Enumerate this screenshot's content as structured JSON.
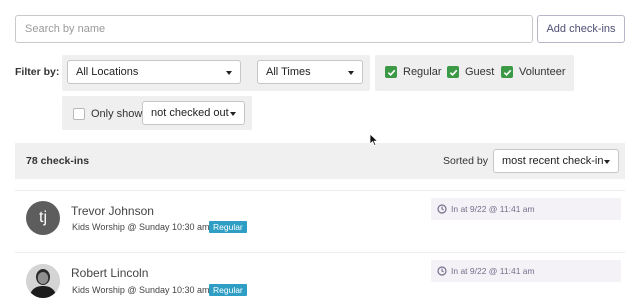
{
  "search": {
    "placeholder": "Search by name",
    "value": ""
  },
  "add_button": "Add check-ins",
  "filters": {
    "label": "Filter by:",
    "location": "All Locations",
    "time": "All Times",
    "kinds": [
      {
        "label": "Regular",
        "checked": true
      },
      {
        "label": "Guest",
        "checked": true
      },
      {
        "label": "Volunteer",
        "checked": true
      }
    ],
    "only_show": {
      "label": "Only show",
      "checked": false,
      "value": "not checked out"
    }
  },
  "summary": {
    "count": "78 check-ins",
    "sorted_label": "Sorted by",
    "sort_value": "most recent check-in"
  },
  "checkins": [
    {
      "name": "Trevor Johnson",
      "initials": "tj",
      "event": "Kids Worship @ Sunday 10:30 am",
      "badge": "Regular",
      "time": "In at 9/22 @ 11:41 am"
    },
    {
      "name": "Robert Lincoln",
      "initials": "",
      "event": "Kids Worship @ Sunday 10:30 am",
      "badge": "Regular",
      "time": "In at 9/22 @ 11:41 am"
    }
  ],
  "colors": {
    "checkbox_green": "#3c9a46",
    "badge_blue": "#2f9ec4",
    "pill_bg": "#f4f1f7"
  }
}
